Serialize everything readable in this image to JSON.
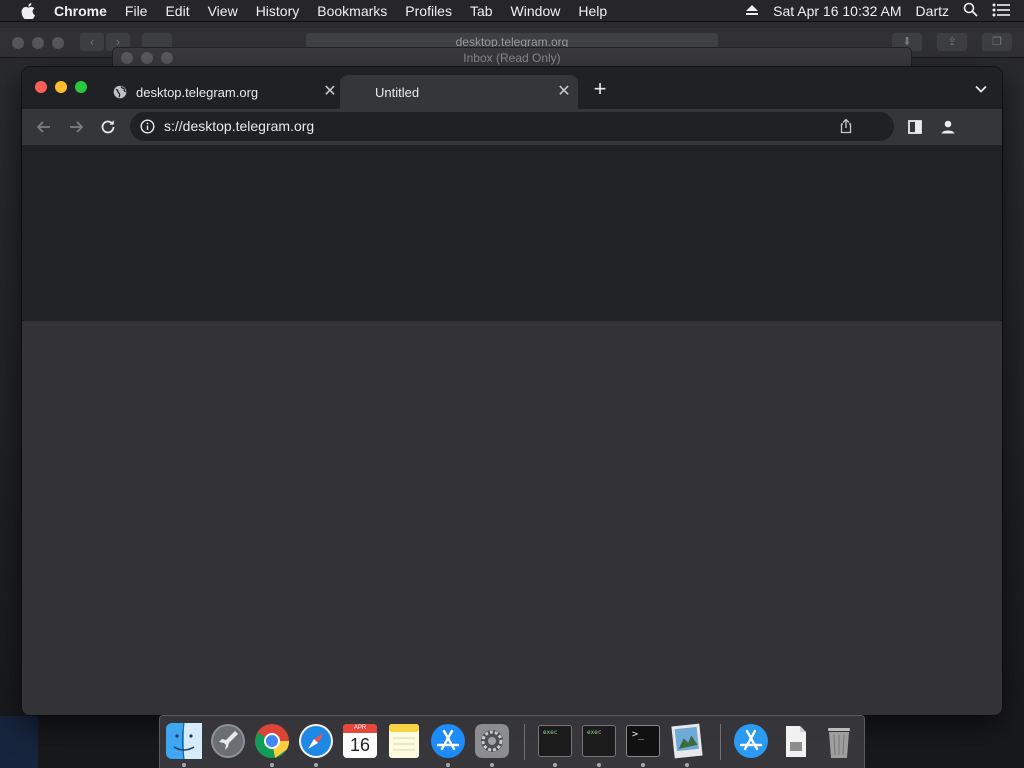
{
  "menubar": {
    "app_name": "Chrome",
    "items": [
      "File",
      "Edit",
      "View",
      "History",
      "Bookmarks",
      "Profiles",
      "Tab",
      "Window",
      "Help"
    ],
    "clock": "Sat Apr 16  10:32 AM",
    "user": "Dartz",
    "icons": [
      "apple-icon",
      "eject-icon",
      "spotlight-search-icon",
      "control-center-icon"
    ]
  },
  "background_window": {
    "url": "desktop.telegram.org"
  },
  "mail_window": {
    "title": "Inbox (Read Only)"
  },
  "chrome": {
    "tabs": [
      {
        "label": "desktop.telegram.org",
        "icon": "globe-icon",
        "active": false
      },
      {
        "label": "Untitled",
        "icon": "",
        "active": true
      }
    ],
    "address": "s://desktop.telegram.org",
    "colors": {
      "tabstrip": "#202124",
      "toolbar": "#35363a",
      "omnibox": "#202124",
      "page_top": "#212225",
      "page_body": "#333335",
      "close_red": "#ff5f57",
      "minimize_yellow": "#febc2e",
      "zoom_green": "#28c840"
    }
  },
  "dock": {
    "items": [
      {
        "name": "Finder",
        "icon": "finder-icon",
        "running": true
      },
      {
        "name": "Launchpad",
        "icon": "launchpad-icon",
        "running": false
      },
      {
        "name": "Google Chrome",
        "icon": "chrome-icon",
        "running": true
      },
      {
        "name": "Safari",
        "icon": "safari-icon",
        "running": true
      },
      {
        "name": "Calendar",
        "icon": "calendar-icon",
        "running": false,
        "month": "APR",
        "day": "16"
      },
      {
        "name": "Notes",
        "icon": "notes-icon",
        "running": false
      },
      {
        "name": "App Store",
        "icon": "app-store-icon",
        "running": true
      },
      {
        "name": "System Preferences",
        "icon": "system-preferences-icon",
        "running": true
      },
      {
        "name": "Terminal exec 1",
        "icon": "exec-terminal-icon",
        "running": true,
        "label": "exec"
      },
      {
        "name": "Terminal exec 2",
        "icon": "exec-terminal-icon",
        "running": true,
        "label": "exec"
      },
      {
        "name": "Terminal",
        "icon": "terminal-icon",
        "running": true,
        "label": ">_"
      },
      {
        "name": "Preview",
        "icon": "preview-icon",
        "running": true
      },
      {
        "name": "Applications",
        "icon": "applications-folder-icon",
        "running": false
      },
      {
        "name": "Downloads",
        "icon": "downloads-stack-icon",
        "running": false
      },
      {
        "name": "Trash",
        "icon": "trash-icon",
        "running": false
      }
    ]
  }
}
